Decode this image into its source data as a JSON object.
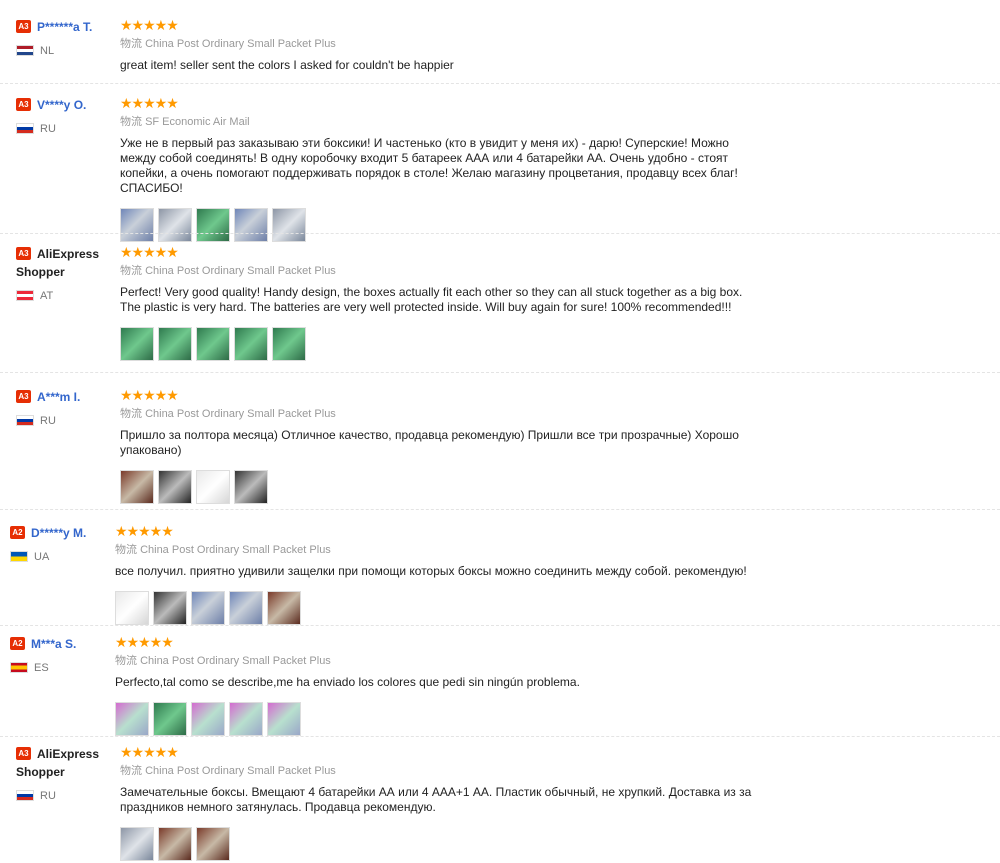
{
  "shipping_label": "物流",
  "reviews": [
    {
      "level": "A3",
      "name": "P******a T.",
      "country": "NL",
      "stars": "★★★★★",
      "shipping": "China Post Ordinary Small Packet Plus",
      "text": "great item! seller sent the colors I asked for couldn't be happier",
      "photos": []
    },
    {
      "level": "A3",
      "name": "V****y O.",
      "country": "RU",
      "stars": "★★★★★",
      "shipping": "SF Economic Air Mail",
      "text": "Уже не в первый раз заказываю эти боксики! И частенько (кто в увидит у меня их) - дарю! Суперские! Можно между собой соединять! В одну коробочку входит 5 батареек ААА или 4 батарейки АА. Очень удобно - стоят копейки, а очень помогают поддерживать порядок в столе! Желаю магазину процветания, продавцу всех благ! СПАСИБО!",
      "photos": [
        "photo",
        "photo",
        "photo",
        "photo",
        "photo"
      ]
    },
    {
      "level": "A3",
      "name": "AliExpress Shopper",
      "country": "AT",
      "stars": "★★★★★",
      "shipping": "China Post Ordinary Small Packet Plus",
      "text": "Perfect! Very good quality! Handy design, the boxes actually fit each other so they can all stuck together as a big box. The plastic is very hard. The batteries are very well protected inside. Will buy again for sure! 100% recommended!!!",
      "photos": [
        "photo",
        "photo",
        "photo",
        "photo",
        "photo"
      ]
    },
    {
      "level": "A3",
      "name": "A***m I.",
      "country": "RU",
      "stars": "★★★★★",
      "shipping": "China Post Ordinary Small Packet Plus",
      "text": "Пришло за полтора месяца) Отличное качество, продавца рекомендую) Пришли все три прозрачные) Хорошо упаковано)",
      "photos": [
        "photo",
        "photo",
        "photo",
        "photo"
      ]
    },
    {
      "level": "A2",
      "name": "D*****y M.",
      "country": "UA",
      "stars": "★★★★★",
      "shipping": "China Post Ordinary Small Packet Plus",
      "text": "все получил. приятно удивили защелки при помощи которых боксы можно соединить между собой. рекомендую!",
      "photos": [
        "photo",
        "photo",
        "photo",
        "photo",
        "photo"
      ]
    },
    {
      "level": "A2",
      "name": "M***a S.",
      "country": "ES",
      "stars": "★★★★★",
      "shipping": "China Post Ordinary Small Packet Plus",
      "text": "Perfecto,tal como se describe,me ha enviado los colores que pedi sin ningún problema.",
      "photos": [
        "photo",
        "photo",
        "photo",
        "photo",
        "photo"
      ]
    },
    {
      "level": "A3",
      "name": "AliExpress Shopper",
      "country": "RU",
      "stars": "★★★★★",
      "shipping": "China Post Ordinary Small Packet Plus",
      "text": "Замечательные боксы. Вмещают 4 батарейки АА или 4 ААА+1 АА. Пластик обычный, не хрупкий. Доставка из за праздников немного затянулась. Продавца рекомендую.",
      "photos": [
        "photo",
        "photo",
        "photo"
      ]
    }
  ]
}
